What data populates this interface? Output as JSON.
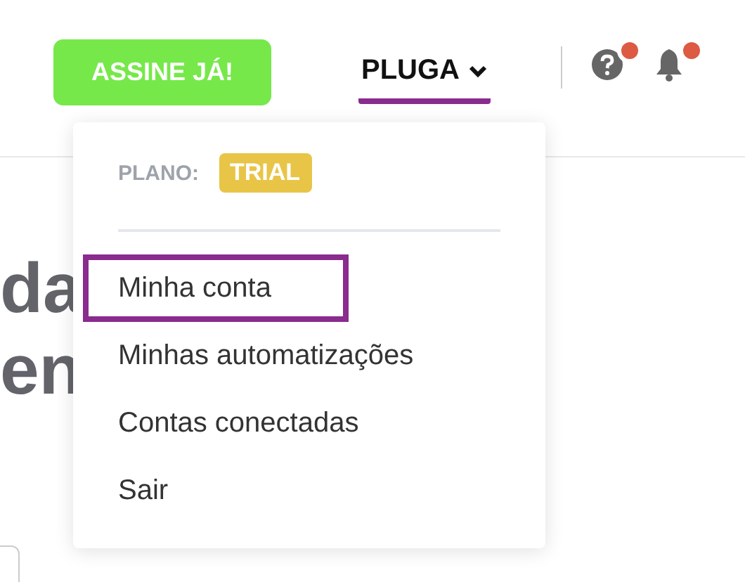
{
  "header": {
    "cta_button": "ASSINE JÁ!",
    "account_menu": {
      "label": "PLUGA",
      "expanded": true
    },
    "help_badge": true,
    "notifications_badge": true
  },
  "background_heading": [
    "da",
    "en"
  ],
  "dropdown": {
    "plan_label": "PLANO:",
    "plan_badge": "TRIAL",
    "items": [
      {
        "label": "Minha conta",
        "selected": true
      },
      {
        "label": "Minhas automatizações",
        "selected": false
      },
      {
        "label": "Contas conectadas",
        "selected": false
      },
      {
        "label": "Sair",
        "selected": false
      }
    ]
  }
}
